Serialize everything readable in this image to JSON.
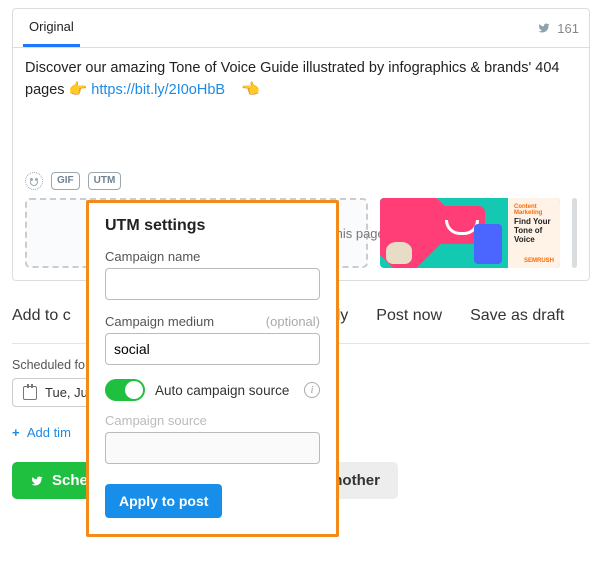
{
  "tab": {
    "original": "Original"
  },
  "char_counter": "161",
  "compose": {
    "text_before": "Discover our amazing Tone of Voice Guide illustrated by infographics & brands' 404 pages ",
    "link_text": "https://bit.ly/2I0oHbB",
    "emoji_right": "👉",
    "emoji_left": "👈"
  },
  "tools": {
    "gif": "GIF",
    "utm": "UTM"
  },
  "dropzone": {
    "hint_suffix": " this page →"
  },
  "preview": {
    "category": "Content Marketing",
    "headline": "Find Your Tone of Voice",
    "brand": "SEMRUSH"
  },
  "addrow": {
    "prefix": "Add to c",
    "mid_tail": "ly",
    "postnow": "Post now",
    "savedraft": "Save as draft"
  },
  "schedule": {
    "label_prefix": "Scheduled fo",
    "date_prefix": "Tue, Jul",
    "add_time_prefix": "Add tim"
  },
  "actions": {
    "schedule": "Schedule",
    "schedule_another": "Schedule & create another"
  },
  "utm": {
    "title": "UTM settings",
    "name_label": "Campaign name",
    "name_value": "",
    "medium_label": "Campaign medium",
    "medium_optional": "(optional)",
    "medium_value": "social",
    "auto_source_label": "Auto campaign source",
    "source_label": "Campaign source",
    "source_value": "",
    "apply": "Apply to post"
  }
}
